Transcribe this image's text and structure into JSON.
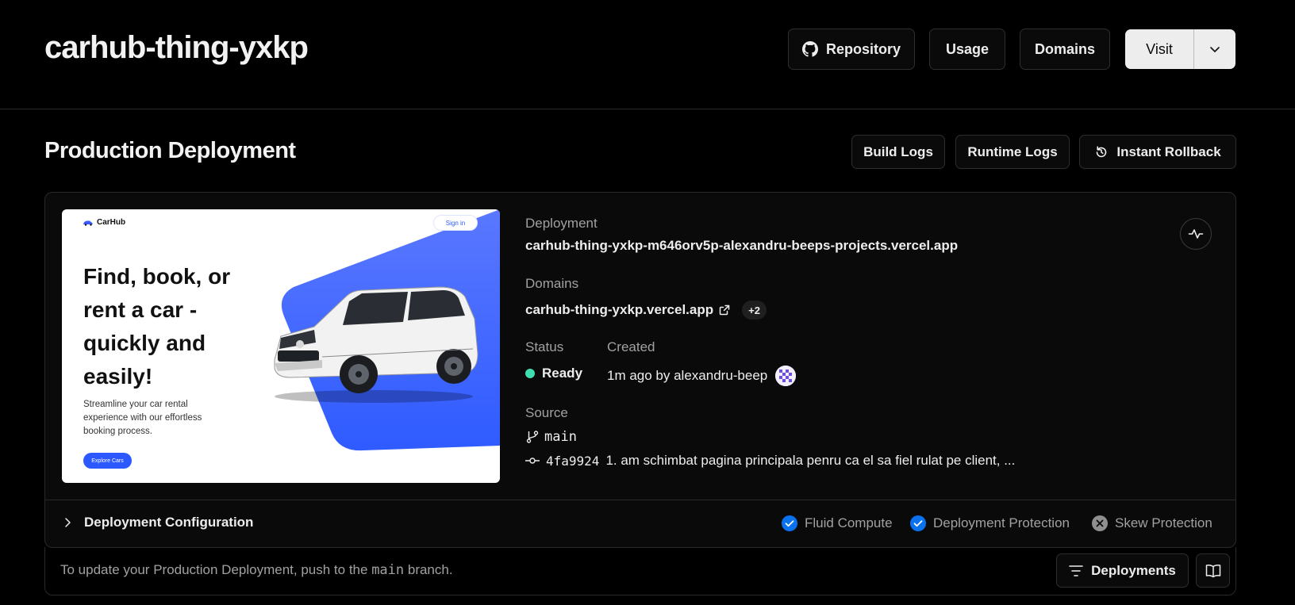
{
  "header": {
    "project_name": "carhub-thing-yxkp",
    "repository_label": "Repository",
    "usage_label": "Usage",
    "domains_label": "Domains",
    "visit_label": "Visit"
  },
  "production": {
    "title": "Production Deployment",
    "build_logs_label": "Build Logs",
    "runtime_logs_label": "Runtime Logs",
    "rollback_label": "Instant Rollback"
  },
  "preview": {
    "brand": "CarHub",
    "signin": "Sign in",
    "headline": "Find, book, or rent a car - quickly and easily!",
    "subtext": "Streamline your car rental experience with our effortless booking process.",
    "cta": "Explore Cars"
  },
  "details": {
    "deployment_label": "Deployment",
    "deployment_url": "carhub-thing-yxkp-m646orv5p-alexandru-beeps-projects.vercel.app",
    "domains_label": "Domains",
    "domain": "carhub-thing-yxkp.vercel.app",
    "extra_domains": "+2",
    "status_label": "Status",
    "status_value": "Ready",
    "status_color": "#3ddfb0",
    "created_label": "Created",
    "created_value": "1m ago by alexandru-beep",
    "source_label": "Source",
    "branch": "main",
    "commit_hash": "4fa9924",
    "commit_message": "1. am schimbat pagina principala penru ca el sa fiel rulat pe client, ..."
  },
  "config": {
    "label": "Deployment Configuration",
    "features": [
      {
        "label": "Fluid Compute",
        "enabled": true
      },
      {
        "label": "Deployment Protection",
        "enabled": true
      },
      {
        "label": "Skew Protection",
        "enabled": false
      }
    ],
    "accent": "#0a72ef"
  },
  "footer": {
    "text_before": "To update your Production Deployment, push to the ",
    "branch": "main",
    "text_after": " branch.",
    "deployments_label": "Deployments"
  }
}
